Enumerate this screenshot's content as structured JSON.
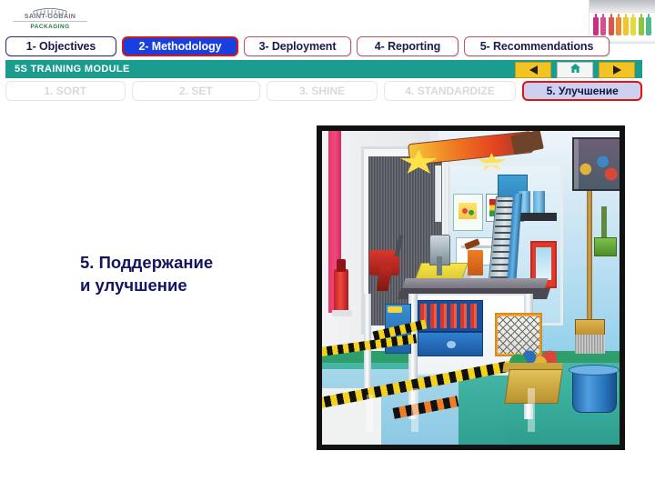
{
  "brand": {
    "logo_name": "SAINT-GOBAIN",
    "logo_sub": "PACKAGING",
    "logo_mark_icon": "arch-building-icon",
    "logo_name_color": "#6b7280",
    "logo_sub_color": "#1f7a3d"
  },
  "photo": {
    "name": "colored-bottles-photo",
    "bottle_colors": [
      "#c9307f",
      "#d94f8e",
      "#e0524a",
      "#ef8a2a",
      "#f2c52c",
      "#e8d93a",
      "#8cc63f",
      "#52b98f"
    ]
  },
  "main_tabs": [
    {
      "label": "1- Objectives",
      "active": false,
      "border_color": "#2b2b6e"
    },
    {
      "label": "2- Methodology",
      "active": true,
      "border_color": "#d01a1a",
      "fill_color": "#1a3fe0",
      "text_color": "#ffffff"
    },
    {
      "label": "3- Deployment",
      "active": false,
      "border_color": "#b05a66"
    },
    {
      "label": "4- Reporting",
      "active": false,
      "border_color": "#b05a66"
    },
    {
      "label": "5- Recommendations",
      "active": false,
      "border_color": "#b05a66"
    }
  ],
  "module_bar": {
    "title": "5S TRAINING MODULE",
    "background_color": "#1a9d8f",
    "text_color": "#ffffff",
    "nav": {
      "back_icon": "triangle-left-icon",
      "home_icon": "house-icon",
      "forward_icon": "triangle-right-icon",
      "button_color": "#f2c423"
    }
  },
  "sub_tabs": [
    {
      "label": "1. SORT",
      "active": false
    },
    {
      "label": "2. SET",
      "active": false
    },
    {
      "label": "3. SHINE",
      "active": false
    },
    {
      "label": "4. STANDARDIZE",
      "active": false
    },
    {
      "label": "5. Улучшение",
      "active": true,
      "fill_color": "#cdd0ee",
      "border_color": "#e01414",
      "text_color": "#131344"
    }
  ],
  "slide": {
    "heading_line1": "5. Поддержание",
    "heading_line2": "и улучшение",
    "heading_color": "#141461",
    "illustration": {
      "name": "organized-workshop-illustration",
      "description_parts": [
        "strip-curtain-doorway",
        "fire-extinguisher",
        "overhead-jib-crane",
        "shadow-board-with-charts",
        "blue-drill-press-machine",
        "workbench-with-vise",
        "oil-can",
        "red-power-drill",
        "tool-drawer-unit",
        "expanded-metal-mesh-panel",
        "wall-poster",
        "broom",
        "green-squeegee",
        "supply-crate",
        "blue-mop-bucket",
        "yellow-black-floor-marking-tape",
        "orange-black-floor-marking-tape"
      ]
    }
  }
}
